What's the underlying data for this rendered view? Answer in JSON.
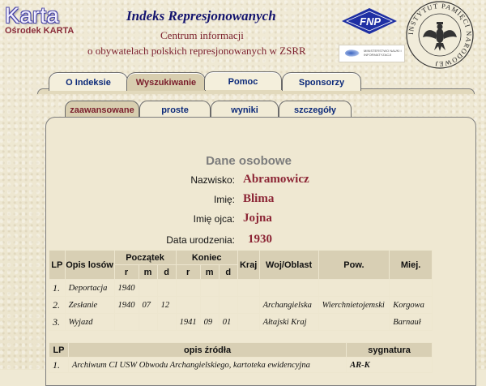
{
  "header": {
    "logo_name": "Karta",
    "logo_sub": "Ośrodek KARTA",
    "title": "Indeks Represjonowanych",
    "subtitle_line1": "Centrum informacji",
    "subtitle_line2": "o obywatelach polskich represjonowanych w ZSRR",
    "partner_fnp": "FNP",
    "partner_ministry": "MINISTERSTWO NAUKI I INFORMATYZACJI",
    "seal_text": "INSTYTUT PAMIĘCI NARODOWEJ"
  },
  "tabs": [
    {
      "label": "O Indeksie"
    },
    {
      "label": "Wyszukiwanie"
    },
    {
      "label": "Pomoc"
    },
    {
      "label": "Sponsorzy"
    }
  ],
  "subtabs": [
    {
      "label": "zaawansowane"
    },
    {
      "label": "proste"
    },
    {
      "label": "wyniki"
    },
    {
      "label": "szczegóły"
    }
  ],
  "section_title": "Dane osobowe",
  "person": {
    "surname_label": "Nazwisko:",
    "surname": "Abramowicz",
    "name_label": "Imię:",
    "name": "Blima",
    "father_label": "Imię ojca:",
    "father": "Jojna",
    "birth_label": "Data urodzenia:",
    "birth": "1930"
  },
  "events_table": {
    "headers": {
      "lp": "LP",
      "opis": "Opis losów",
      "poczatek": "Początek",
      "koniec": "Koniec",
      "kraj": "Kraj",
      "woj": "Woj/Oblast",
      "pow": "Pow.",
      "miej": "Miej.",
      "r": "r",
      "m": "m",
      "d": "d"
    },
    "rows": [
      {
        "lp": "1.",
        "opis": "Deportacja",
        "pr": "1940",
        "pm": "",
        "pd": "",
        "kr": "",
        "km": "",
        "kd": "",
        "kraj": "",
        "woj": "",
        "pow": "",
        "miej": ""
      },
      {
        "lp": "2.",
        "opis": "Zesłanie",
        "pr": "1940",
        "pm": "07",
        "pd": "12",
        "kr": "",
        "km": "",
        "kd": "",
        "kraj": "",
        "woj": "Archangielska",
        "pow": "Wierchnietojemski",
        "miej": "Korgowa"
      },
      {
        "lp": "3.",
        "opis": "Wyjazd",
        "pr": "",
        "pm": "",
        "pd": "",
        "kr": "1941",
        "km": "09",
        "kd": "01",
        "kraj": "",
        "woj": "Ałtajski Kraj",
        "pow": "",
        "miej": "Barnauł"
      }
    ]
  },
  "sources_table": {
    "headers": {
      "lp": "LP",
      "opis": "opis źródła",
      "sygnatura": "sygnatura"
    },
    "rows": [
      {
        "lp": "1.",
        "opis": "Archiwum CI USW Obwodu Archangielskiego, kartoteka ewidencyjna",
        "sygnatura": "AR-K"
      }
    ]
  },
  "colors": {
    "accent": "#8c2535",
    "link": "#0c2a7a",
    "header_bg": "#d8cfb4"
  }
}
